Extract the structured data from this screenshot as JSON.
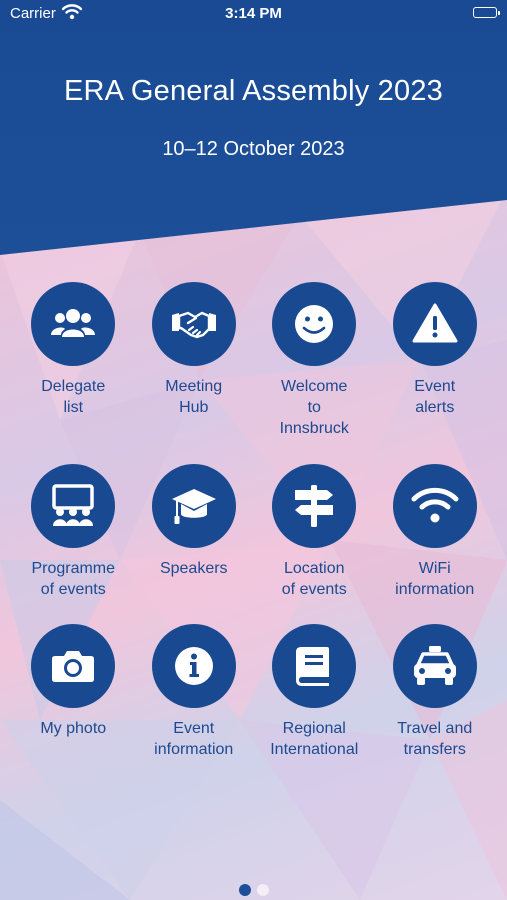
{
  "status_bar": {
    "carrier": "Carrier",
    "time": "3:14 PM"
  },
  "header": {
    "title": "ERA General Assembly 2023",
    "dates": "10–12 October 2023"
  },
  "colors": {
    "brand_blue": "#194a91",
    "label_blue": "#1d4a8f"
  },
  "tiles": [
    {
      "label": "Delegate\nlist",
      "icon": "group-icon"
    },
    {
      "label": "Meeting\nHub",
      "icon": "handshake-icon"
    },
    {
      "label": "Welcome\nto\nInnsbruck",
      "icon": "smiley-icon"
    },
    {
      "label": "Event\nalerts",
      "icon": "warning-icon"
    },
    {
      "label": "Programme\nof events",
      "icon": "presentation-icon"
    },
    {
      "label": "Speakers",
      "icon": "graduation-cap-icon"
    },
    {
      "label": "Location\nof events",
      "icon": "signpost-icon"
    },
    {
      "label": "WiFi\ninformation",
      "icon": "wifi-icon"
    },
    {
      "label": "My photo",
      "icon": "camera-icon"
    },
    {
      "label": "Event\ninformation",
      "icon": "info-icon"
    },
    {
      "label": "Regional\nInternational",
      "icon": "book-icon"
    },
    {
      "label": "Travel and\ntransfers",
      "icon": "taxi-icon"
    }
  ],
  "pager": {
    "pages": 2,
    "current": 1
  }
}
